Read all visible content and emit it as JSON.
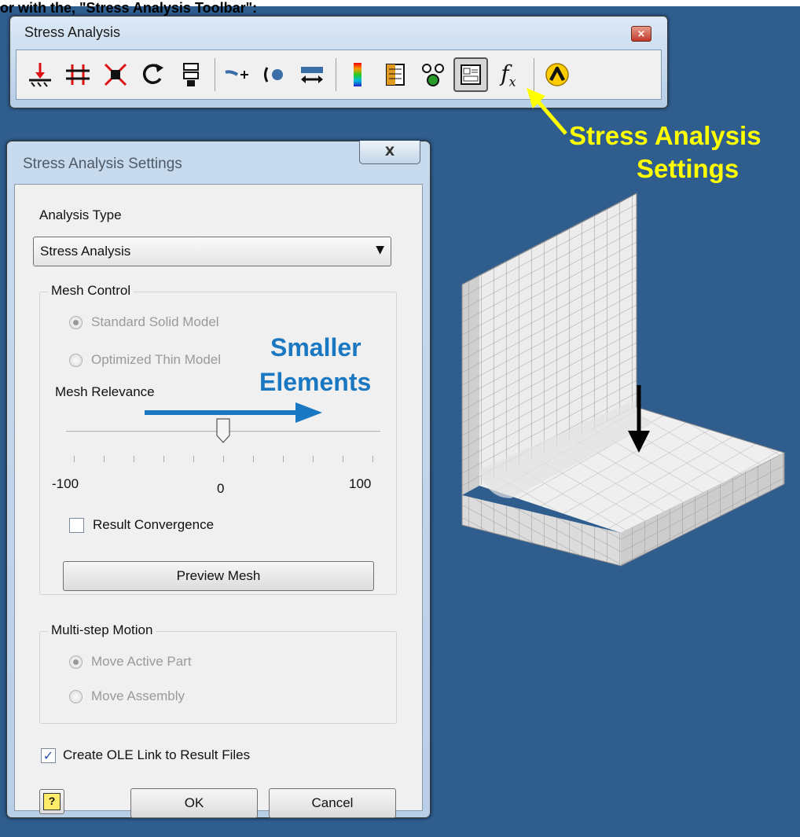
{
  "caption": "or with the, \"Stress Analysis Toolbar\":",
  "toolbar": {
    "title": "Stress Analysis",
    "close_glyph": "×",
    "fx_glyph": "f",
    "fx_sub": "x",
    "buttons": [
      {
        "icon": "fixed-constraint-icon"
      },
      {
        "icon": "pin-constraint-icon"
      },
      {
        "icon": "frictionless-constraint-icon"
      },
      {
        "icon": "moment-icon"
      },
      {
        "icon": "bearing-load-icon"
      },
      {
        "icon": "pressure-icon"
      },
      {
        "icon": "force-icon"
      },
      {
        "icon": "body-load-icon"
      },
      {
        "icon": "color-bar-icon"
      },
      {
        "icon": "report-icon"
      },
      {
        "icon": "animate-results-icon"
      },
      {
        "icon": "stress-analysis-settings-icon",
        "active": true
      },
      {
        "icon": "parameters-fx-icon"
      },
      {
        "icon": "update-icon"
      }
    ]
  },
  "dialog": {
    "title": "Stress Analysis Settings",
    "close_glyph": "X",
    "analysis_type_label": "Analysis Type",
    "analysis_type_value": "Stress Analysis",
    "mesh_control": {
      "legend": "Mesh Control",
      "standard_solid_model": "Standard Solid Model",
      "optimized_thin_model": "Optimized Thin Model",
      "selected": "Standard Solid Model"
    },
    "mesh_relevance": {
      "label": "Mesh Relevance",
      "min": -100,
      "max": 100,
      "value": 0,
      "min_label": "-100",
      "mid_label": "0",
      "max_label": "100"
    },
    "result_convergence": {
      "label": "Result Convergence",
      "checked": false
    },
    "preview_mesh_label": "Preview Mesh",
    "multi_step_motion": {
      "legend": "Multi-step Motion",
      "move_active_part": "Move Active Part",
      "move_assembly": "Move Assembly",
      "selected": "Move Active Part"
    },
    "ole_link": {
      "label": "Create OLE Link to Result Files",
      "checked": true,
      "check_glyph": "✓"
    },
    "help_glyph": "?",
    "ok_label": "OK",
    "cancel_label": "Cancel"
  },
  "annotations": {
    "settings_callout_line1": "Stress Analysis",
    "settings_callout_line2": "Settings",
    "smaller_line1": "Smaller",
    "smaller_line2": "Elements"
  },
  "colors": {
    "background": "#2f5d8e",
    "callout_yellow": "#ffff00",
    "annotation_blue": "#1a78c2",
    "mesh_face": "#e8e8e8"
  }
}
